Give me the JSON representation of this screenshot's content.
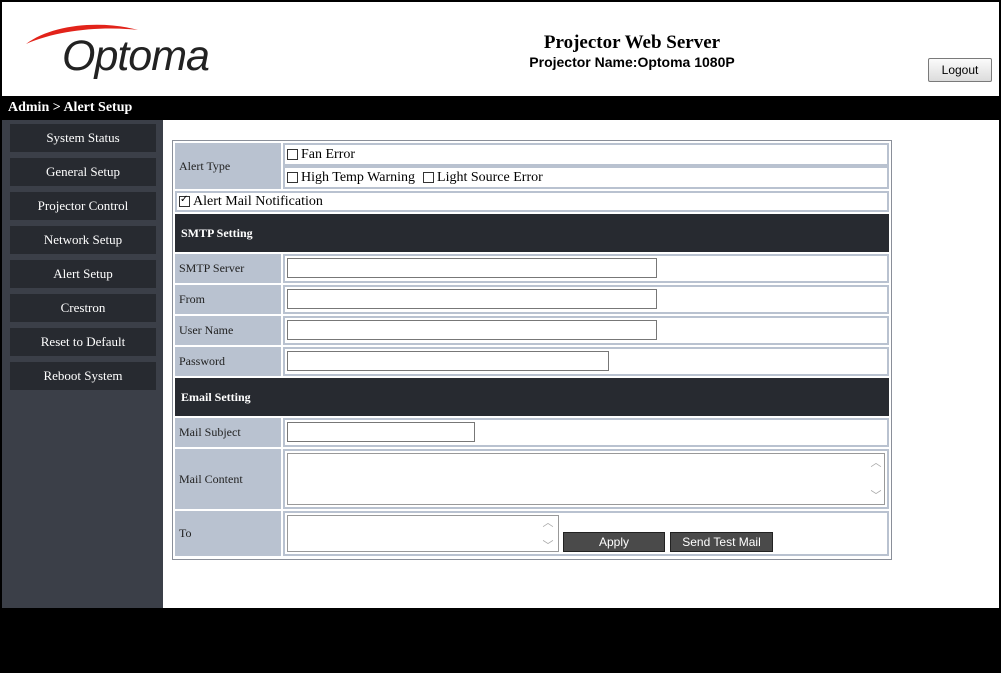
{
  "header": {
    "logo_text": "Optoma",
    "title": "Projector Web Server",
    "projector_name": "Projector Name:Optoma 1080P",
    "logout_label": "Logout"
  },
  "breadcrumb": "Admin > Alert Setup",
  "sidebar": {
    "items": [
      {
        "label": "System Status"
      },
      {
        "label": "General Setup"
      },
      {
        "label": "Projector Control"
      },
      {
        "label": "Network Setup"
      },
      {
        "label": "Alert Setup"
      },
      {
        "label": "Crestron"
      },
      {
        "label": "Reset to Default"
      },
      {
        "label": "Reboot System"
      }
    ]
  },
  "form": {
    "alert_type_label": "Alert Type",
    "fan_error": {
      "label": "Fan Error",
      "checked": false
    },
    "high_temp": {
      "label": "High Temp Warning",
      "checked": false
    },
    "light_source": {
      "label": "Light Source Error",
      "checked": false
    },
    "alert_mail": {
      "label": "Alert Mail Notification",
      "checked": true
    },
    "smtp_section": "SMTP Setting",
    "smtp_server": {
      "label": "SMTP Server",
      "value": ""
    },
    "from": {
      "label": "From",
      "value": ""
    },
    "user_name": {
      "label": "User Name",
      "value": ""
    },
    "password": {
      "label": "Password",
      "value": ""
    },
    "email_section": "Email Setting",
    "mail_subject": {
      "label": "Mail Subject",
      "value": ""
    },
    "mail_content": {
      "label": "Mail Content",
      "value": ""
    },
    "to": {
      "label": "To",
      "value": ""
    },
    "apply_label": "Apply",
    "send_test_label": "Send Test Mail"
  },
  "colors": {
    "label_bg": "#b9c2d0",
    "section_bg": "#272a30",
    "sidebar_bg": "#3b3f48",
    "brand_red": "#e2231a"
  }
}
